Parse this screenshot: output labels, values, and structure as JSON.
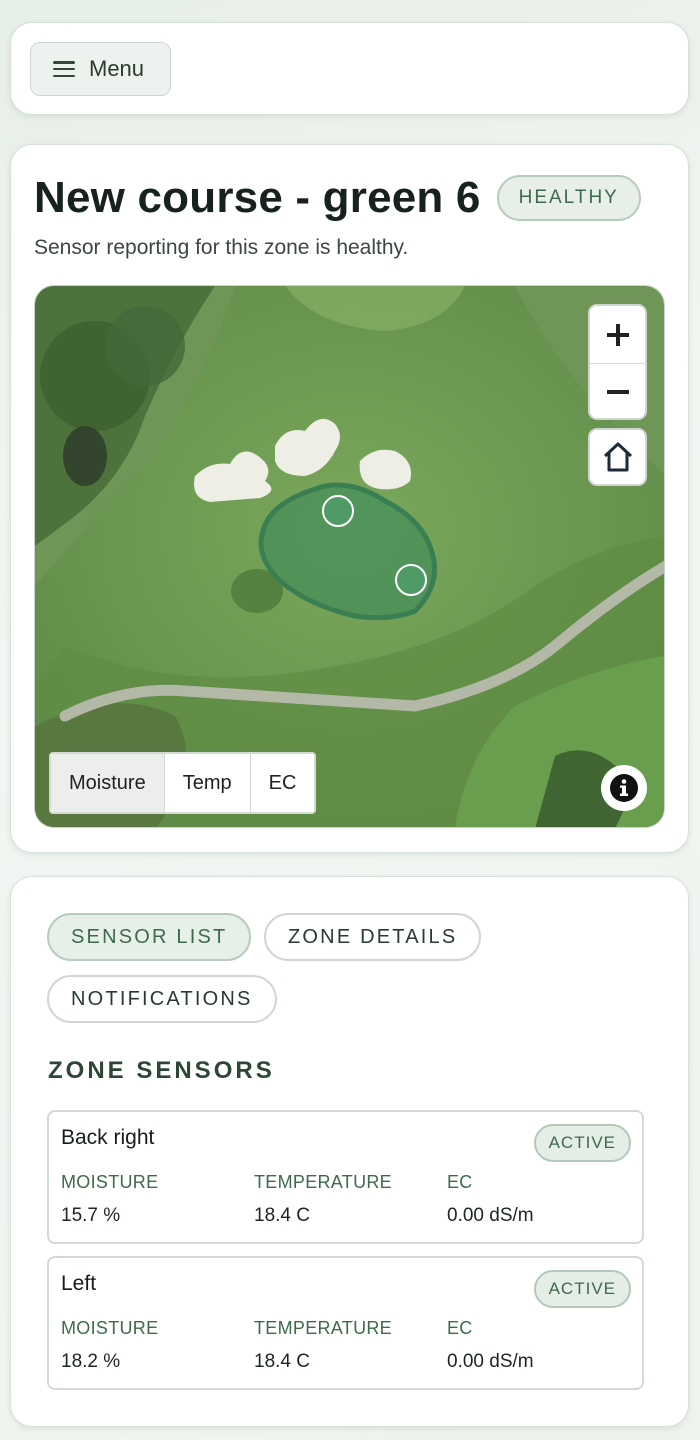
{
  "header": {
    "menu_label": "Menu"
  },
  "zone": {
    "title": "New course - green 6",
    "status_badge": "HEALTHY",
    "subtitle": "Sensor reporting for this zone is healthy."
  },
  "map": {
    "layers": [
      "Moisture",
      "Temp",
      "EC"
    ],
    "active_layer": "Moisture",
    "zoom_in_icon": "plus-icon",
    "zoom_out_icon": "minus-icon",
    "home_icon": "home-icon",
    "info_icon": "info-icon",
    "zone_color": "#3f8a5a"
  },
  "tabs": [
    {
      "label": "SENSOR LIST",
      "active": true
    },
    {
      "label": "ZONE DETAILS",
      "active": false
    },
    {
      "label": "NOTIFICATIONS",
      "active": false
    }
  ],
  "sensors_section": {
    "heading": "ZONE SENSORS",
    "sensors": [
      {
        "name": "Back right",
        "status": "ACTIVE",
        "metrics": [
          {
            "label": "MOISTURE",
            "value": "15.7 %"
          },
          {
            "label": "TEMPERATURE",
            "value": "18.4 C"
          },
          {
            "label": "EC",
            "value": "0.00 dS/m"
          }
        ]
      },
      {
        "name": "Left",
        "status": "ACTIVE",
        "metrics": [
          {
            "label": "MOISTURE",
            "value": "18.2 %"
          },
          {
            "label": "TEMPERATURE",
            "value": "18.4 C"
          },
          {
            "label": "EC",
            "value": "0.00 dS/m"
          }
        ]
      }
    ]
  },
  "colors": {
    "accent": "#3e6a4c",
    "badge_bg": "#e6efe8",
    "card_border": "#d8e0da"
  }
}
